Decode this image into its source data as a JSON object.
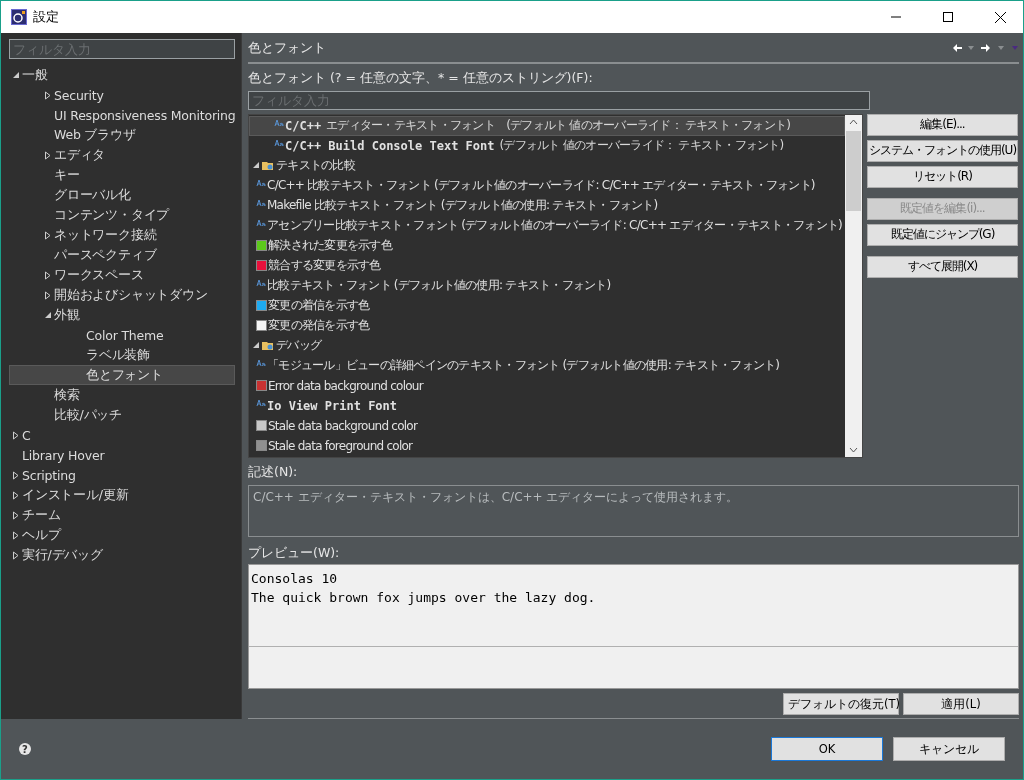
{
  "window": {
    "title": "設定"
  },
  "sidebar": {
    "filter": {
      "placeholder": "フィルタ入力"
    },
    "items": [
      {
        "label": "一般",
        "expanded": true,
        "selected": false,
        "children": [
          {
            "label": "Security",
            "expanded": false,
            "selected": false
          },
          {
            "label": "UI Responsiveness Monitoring",
            "selected": false
          },
          {
            "label": "Web ブラウザ",
            "selected": false
          },
          {
            "label": "エディタ",
            "expanded": false,
            "selected": false
          },
          {
            "label": "キー",
            "selected": false
          },
          {
            "label": "グローバル化",
            "selected": false
          },
          {
            "label": "コンテンツ・タイプ",
            "selected": false
          },
          {
            "label": "ネットワーク接続",
            "expanded": false,
            "selected": false
          },
          {
            "label": "パースペクティブ",
            "selected": false
          },
          {
            "label": "ワークスペース",
            "expanded": false,
            "selected": false
          },
          {
            "label": "開始およびシャットダウン",
            "expanded": false,
            "selected": false
          },
          {
            "label": "外観",
            "expanded": true,
            "selected": false,
            "children": [
              {
                "label": "Color Theme",
                "selected": false
              },
              {
                "label": "ラベル装飾",
                "selected": false
              },
              {
                "label": "色とフォント",
                "selected": true
              }
            ]
          },
          {
            "label": "検索",
            "selected": false
          },
          {
            "label": "比較/パッチ",
            "selected": false
          }
        ]
      },
      {
        "label": "C",
        "expanded": false,
        "selected": false
      },
      {
        "label": "Library Hover",
        "selected": false
      },
      {
        "label": "Scripting",
        "expanded": false,
        "selected": false
      },
      {
        "label": "インストール/更新",
        "expanded": false,
        "selected": false
      },
      {
        "label": "チーム",
        "expanded": false,
        "selected": false
      },
      {
        "label": "ヘルプ",
        "expanded": false,
        "selected": false
      },
      {
        "label": "実行/デバッグ",
        "expanded": false,
        "selected": false
      }
    ]
  },
  "page": {
    "title": "色とフォント",
    "list_label": "色とフォント (? = 任意の文字、* = 任意のストリング)(F):",
    "filter": {
      "placeholder": "フィルタ入力"
    },
    "items": [
      {
        "kind": "font",
        "label": "C/C++",
        "mono": true,
        "note": "エディター・テキスト・フォント　(デフォルト 値のオーバーライド： テキスト・フォント)",
        "selected": true
      },
      {
        "kind": "font",
        "label": "C/C++ Build Console Text Font",
        "mono": true,
        "note": "(デフォルト 値のオーバーライド： テキスト・フォント)",
        "selected": false
      },
      {
        "kind": "category",
        "label": "テキストの比較",
        "expanded": true,
        "selected": false,
        "children": [
          {
            "kind": "font",
            "label": "C/C++ 比較テキスト・フォント (デフォルト値のオーバーライド: C/C++ エディター・テキスト・フォント)",
            "selected": false
          },
          {
            "kind": "font",
            "label": "Makefile 比較テキスト・フォント (デフォルト値の使用: テキスト・フォント)",
            "selected": false
          },
          {
            "kind": "font",
            "label": "アセンブリー比較テキスト・フォント (デフォルト値のオーバーライド: C/C++ エディター・テキスト・フォント)",
            "selected": false
          },
          {
            "kind": "color",
            "label": "解決された変更を示す色",
            "color": "#5cc81c",
            "selected": false
          },
          {
            "kind": "color",
            "label": "競合する変更を示す色",
            "color": "#e8103c",
            "selected": false
          },
          {
            "kind": "font",
            "label": "比較テキスト・フォント (デフォルト値の使用: テキスト・フォント)",
            "selected": false
          },
          {
            "kind": "color",
            "label": "変更の着信を示す色",
            "color": "#1eaaf0",
            "selected": false
          },
          {
            "kind": "color",
            "label": "変更の発信を示す色",
            "color": "#f4f4f4",
            "selected": false
          }
        ]
      },
      {
        "kind": "category",
        "label": "デバッグ",
        "expanded": true,
        "selected": false,
        "children": [
          {
            "kind": "font",
            "label": "「モジュール」ビューの詳細ペインのテキスト・フォント (デフォルト値の使用: テキスト・フォント)",
            "selected": false
          },
          {
            "kind": "color",
            "label": "Error data background colour",
            "color": "#c83232",
            "selected": false
          },
          {
            "kind": "font",
            "label": "Io View Print Font",
            "mono": true,
            "selected": false
          },
          {
            "kind": "color",
            "label": "Stale data background color",
            "color": "#c8c8c8",
            "selected": false
          },
          {
            "kind": "color",
            "label": "Stale data foreground color",
            "color": "#909090",
            "selected": false
          }
        ]
      }
    ],
    "side_buttons": [
      {
        "label": "編集(E)...",
        "disabled": false
      },
      {
        "label": "システム・フォントの使用(U)",
        "disabled": false
      },
      {
        "label": "リセット(R)",
        "disabled": false
      },
      {
        "label": "既定値を編集(i)...",
        "disabled": true
      },
      {
        "label": "既定値にジャンプ(G)",
        "disabled": false
      },
      {
        "label": "すべて展開(X)",
        "disabled": false
      }
    ],
    "description_label": "記述(N):",
    "description": "C/C++ エディター・テキスト・フォントは、C/C++ エディターによって使用されます。",
    "preview_label": "プレビュー(W):",
    "preview_lines": [
      "Consolas 10",
      "The quick brown fox jumps over the lazy dog."
    ],
    "page_buttons": [
      {
        "label": "デフォルトの復元(T)"
      },
      {
        "label": "適用(L)"
      }
    ]
  },
  "footer": {
    "help": "?",
    "buttons": [
      {
        "label": "OK",
        "default": true
      },
      {
        "label": "キャンセル",
        "default": false
      }
    ]
  }
}
